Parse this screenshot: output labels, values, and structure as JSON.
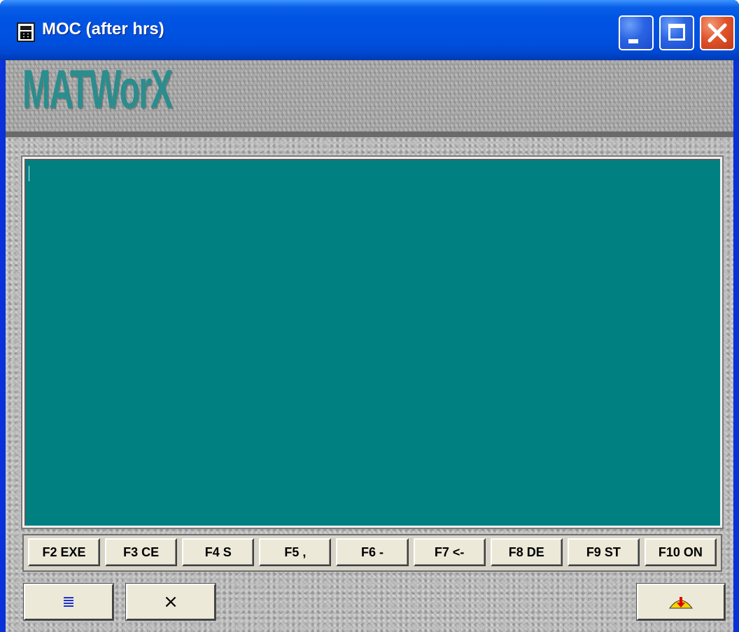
{
  "window": {
    "title": "MOC (after hrs)",
    "icon": "calculator-icon",
    "controls": [
      "minimize-icon",
      "maximize-icon",
      "close-icon"
    ]
  },
  "banner": {
    "logo": "MATWorX"
  },
  "display": {
    "value": "",
    "background": "#008080"
  },
  "function_keys": [
    {
      "label": "F2 EXE"
    },
    {
      "label": "F3 CE"
    },
    {
      "label": "F4 S"
    },
    {
      "label": "F5 ,"
    },
    {
      "label": "F6 -"
    },
    {
      "label": "F7 <-"
    },
    {
      "label": "F8 DE"
    },
    {
      "label": "F9 ST"
    },
    {
      "label": "F10 ON"
    }
  ],
  "bottom_buttons": {
    "list_icon": "list-icon",
    "clear_label": "×",
    "download_icon": "warning-down-arrow-icon"
  },
  "colors": {
    "titlebar": "#0054e3",
    "logo": "#2b8d8d",
    "button_face": "#ece9d8"
  }
}
